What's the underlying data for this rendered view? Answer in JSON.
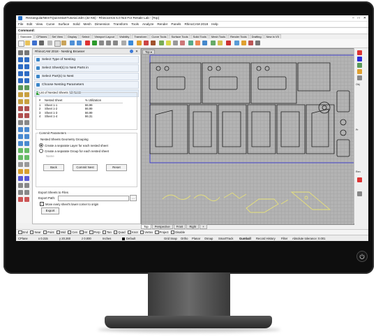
{
  "window": {
    "title": "RectangularNESTQuickStartTutorial.3dm (32 KB) - Rhinoceros 5.0 Not For Resale Lab - [Top]",
    "controls": [
      "–",
      "□",
      "✕"
    ]
  },
  "menu": [
    "File",
    "Edit",
    "View",
    "Curve",
    "Surface",
    "Solid",
    "Mesh",
    "Dimension",
    "Transform",
    "Tools",
    "Analyze",
    "Render",
    "Panels",
    "RhinoCAM 2018",
    "Help"
  ],
  "command": {
    "label": "Command:",
    "value": ""
  },
  "toolbar_tabs": [
    {
      "label": "Standard",
      "active": true
    },
    {
      "label": "CPlanes"
    },
    {
      "label": "Set View"
    },
    {
      "label": "Display"
    },
    {
      "label": "Select"
    },
    {
      "label": "Viewport Layout"
    },
    {
      "label": "Visibility"
    },
    {
      "label": "Transform"
    },
    {
      "label": "Curve Tools"
    },
    {
      "label": "Surface Tools"
    },
    {
      "label": "Solid Tools"
    },
    {
      "label": "Mesh Tools"
    },
    {
      "label": "Render Tools"
    },
    {
      "label": "Drafting"
    },
    {
      "label": "New in V5"
    }
  ],
  "panel": {
    "title": "RhinoCAM 2018 - Nesting Browser",
    "close": "✕",
    "steps": [
      "Select Type of Nesting",
      "Select Sheet(s) to Nest Parts in",
      "Select Part(s) to Nest",
      "Choose Nesting Parameters",
      "Preview And Commit Nest"
    ],
    "nested_group": {
      "title": "List of Nested Sheets",
      "headers": [
        "#",
        "Nested Sheet",
        "% Utilization"
      ],
      "rows": [
        [
          "1",
          "Sheet 1-1",
          "86.99"
        ],
        [
          "2",
          "Sheet 1-2",
          "86.99"
        ],
        [
          "3",
          "Sheet 1-3",
          "86.99"
        ],
        [
          "4",
          "Sheet 1-4",
          "86.31"
        ]
      ]
    },
    "commit_group": {
      "title": "Commit Parameters",
      "sub": "Nested Sheets Geometry Grouping",
      "option1": "Create a separate Layer for each nested sheet",
      "option2": "Create a separate Group for each nested sheet",
      "name_label": "Name",
      "back": "Back",
      "commit": "Commit Nest",
      "reset": "Reset"
    },
    "export": {
      "title": "Export Sheets to Files",
      "path_label": "Export Path:",
      "path_value": "",
      "browse": "...",
      "move_label": "Move every sheet's lower corner to origin",
      "export_btn": "Export"
    }
  },
  "viewport": {
    "tab": "Top ▾",
    "bottom_tabs": [
      "Top",
      "Perspective",
      "Front",
      "Right",
      "+"
    ]
  },
  "right_panel": {
    "labels": [
      "Obj",
      "Pr",
      "Ren"
    ]
  },
  "osnap": [
    "End",
    "Near",
    "Point",
    "Mid",
    "Cen",
    "Int",
    "Perp",
    "Tan",
    "Quad",
    "Knot",
    "Vertex",
    "Project",
    "Disable"
  ],
  "status": {
    "cplane": "CPlane",
    "x": "x 0.315",
    "y": "y 20.260",
    "z": "z 0.000",
    "units": "Inches",
    "layer": "Default",
    "items": [
      "Grid Snap",
      "Ortho",
      "Planar",
      "Osnap",
      "SmartTrack",
      "Gumball",
      "Record History",
      "Filter"
    ],
    "tolerance": "Absolute tolerance: 0.001"
  },
  "colors": {
    "accent": "#2a72c8",
    "sheet_outline": "#2c2cd8",
    "part_line": "#1a1a1a",
    "unnested": "#e6e07a"
  }
}
